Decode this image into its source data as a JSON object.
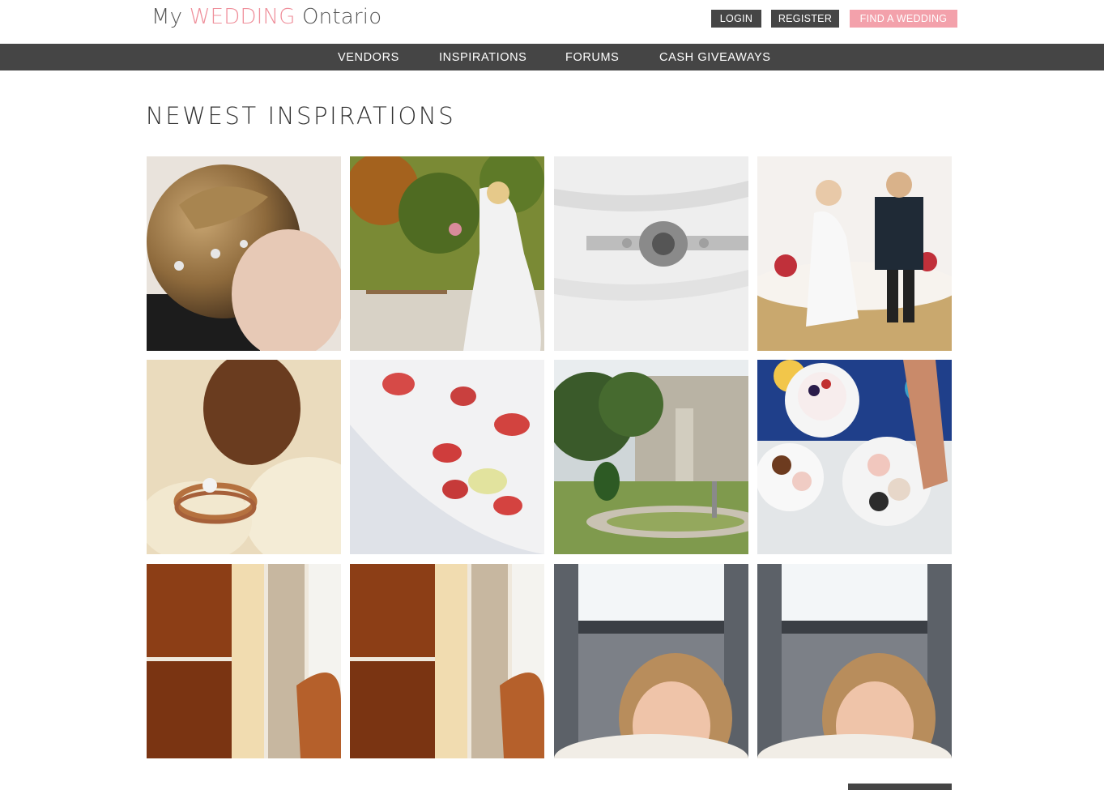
{
  "header": {
    "logo": {
      "prefix": "My",
      "accent": "WEDDING",
      "suffix": "Ontario"
    },
    "login_label": "LOGIN",
    "register_label": "REGISTER",
    "find_label": "FIND A WEDDING"
  },
  "nav": {
    "items": [
      "VENDORS",
      "INSPIRATIONS",
      "FORUMS",
      "CASH GIVEAWAYS"
    ]
  },
  "main": {
    "title": "NEWEST INSPIRATIONS",
    "photos": [
      "bride-hair-updo",
      "bride-in-garden",
      "gown-crystal-belt",
      "cake-topper-couple",
      "wedding-rings",
      "cake-with-petals",
      "estate-garden",
      "desserts-table",
      "wooden-door-dog",
      "wooden-door-dog",
      "selfie-in-car",
      "selfie-in-car"
    ]
  },
  "colors": {
    "brand_pink": "#ef8f9b",
    "button_pink": "#f3a1ab",
    "dark": "#454545"
  }
}
